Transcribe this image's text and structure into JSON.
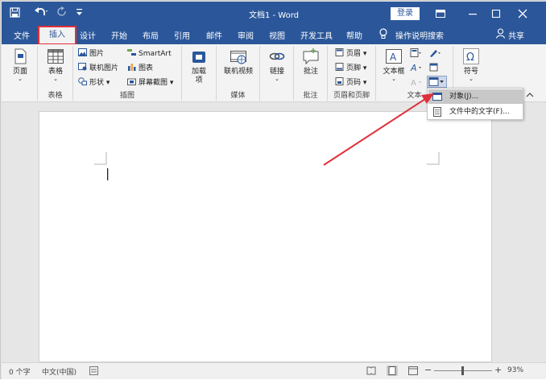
{
  "title_bar": {
    "document_title": "文档1 - Word",
    "login_button": "登录",
    "save_icon": "save-icon",
    "undo_icon": "undo-icon",
    "redo_icon": "redo-icon",
    "customize_icon": "customize-quick-access-icon"
  },
  "tabs": [
    "文件",
    "插入",
    "设计",
    "开始",
    "布局",
    "引用",
    "邮件",
    "审阅",
    "视图",
    "开发工具",
    "帮助"
  ],
  "active_tab": "插入",
  "tell_me": "操作说明搜索",
  "share": "共享",
  "ribbon": {
    "pages": {
      "button": "页面",
      "group": ""
    },
    "tables": {
      "button": "表格",
      "group": "表格"
    },
    "illustrations": {
      "group": "插图",
      "picture": "图片",
      "online_picture": "联机图片",
      "shapes": "形状",
      "smartart": "SmartArt",
      "chart": "图表",
      "screenshot": "屏幕截图"
    },
    "addins": {
      "line1": "加载",
      "line2": "项"
    },
    "media": {
      "online_video": "联机视频",
      "group": "媒体"
    },
    "links": {
      "button": "链接"
    },
    "comments": {
      "button": "批注",
      "group": "批注"
    },
    "header_footer": {
      "header": "页眉",
      "footer": "页脚",
      "page_number": "页码",
      "group": "页眉和页脚"
    },
    "text": {
      "textbox": "文本框",
      "group": "文本"
    },
    "symbols": {
      "button": "符号"
    }
  },
  "dropdown": {
    "items": [
      "对象(J)...",
      "文件中的文字(F)..."
    ]
  },
  "status_bar": {
    "word_count": "0 个字",
    "language": "中文(中国)",
    "zoom": "93%"
  },
  "colors": {
    "accent": "#2b579a",
    "highlight_box": "#e0303a",
    "arrow": "#e0303a"
  }
}
